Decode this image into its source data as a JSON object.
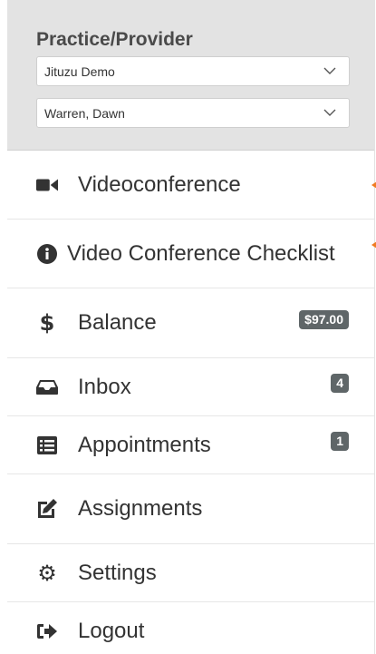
{
  "provider": {
    "title": "Practice/Provider",
    "practice_select": {
      "value": "Jituzu Demo"
    },
    "provider_select": {
      "value": "Warren, Dawn"
    }
  },
  "nav": {
    "videoconference": {
      "label": "Videoconference",
      "icon": "video-camera-icon"
    },
    "checklist": {
      "label": "Video Conference Checklist",
      "icon": "info-circle-icon"
    },
    "balance": {
      "label": "Balance",
      "badge": "$97.00",
      "icon": "dollar-icon"
    },
    "inbox": {
      "label": "Inbox",
      "badge": "4",
      "icon": "inbox-tray-icon"
    },
    "appointments": {
      "label": "Appointments",
      "badge": "1",
      "icon": "list-icon"
    },
    "assignments": {
      "label": "Assignments",
      "icon": "edit-icon"
    },
    "settings": {
      "label": "Settings",
      "icon": "gear-icon"
    },
    "logout": {
      "label": "Logout",
      "icon": "sign-out-icon"
    }
  },
  "colors": {
    "accent_arrow": "#f07b22",
    "badge_bg": "#5f6668",
    "panel_bg": "#e3e3e3"
  }
}
